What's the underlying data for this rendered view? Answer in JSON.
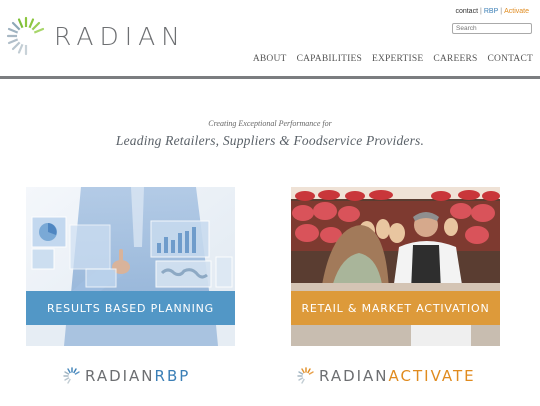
{
  "header": {
    "logo_text": "RADIAN",
    "utility_links": {
      "contact": "contact",
      "separator": "|",
      "rbp": "RBP",
      "activate": "Activate"
    },
    "search_placeholder": "Search",
    "nav": [
      "ABOUT",
      "CAPABILITIES",
      "EXPERTISE",
      "CAREERS",
      "CONTACT"
    ]
  },
  "hero": {
    "tagline_small": "Creating Exceptional Performance for",
    "tagline_large": "Leading Retailers, Suppliers & Foodservice Providers."
  },
  "cards": [
    {
      "banner": "RESULTS BASED PLANNING",
      "brand_main": "RADIAN",
      "brand_sub": "RBP"
    },
    {
      "banner": "RETAIL & MARKET ACTIVATION",
      "brand_main": "RADIAN",
      "brand_sub": "ACTIVATE"
    }
  ],
  "colors": {
    "logo_green": "#8cc63f",
    "rbp_blue": "#3b7fb6",
    "activate_orange": "#e08b1f",
    "banner_blue": "#5297c6",
    "banner_orange": "#dd9a3a",
    "divider": "#7b7d80"
  }
}
